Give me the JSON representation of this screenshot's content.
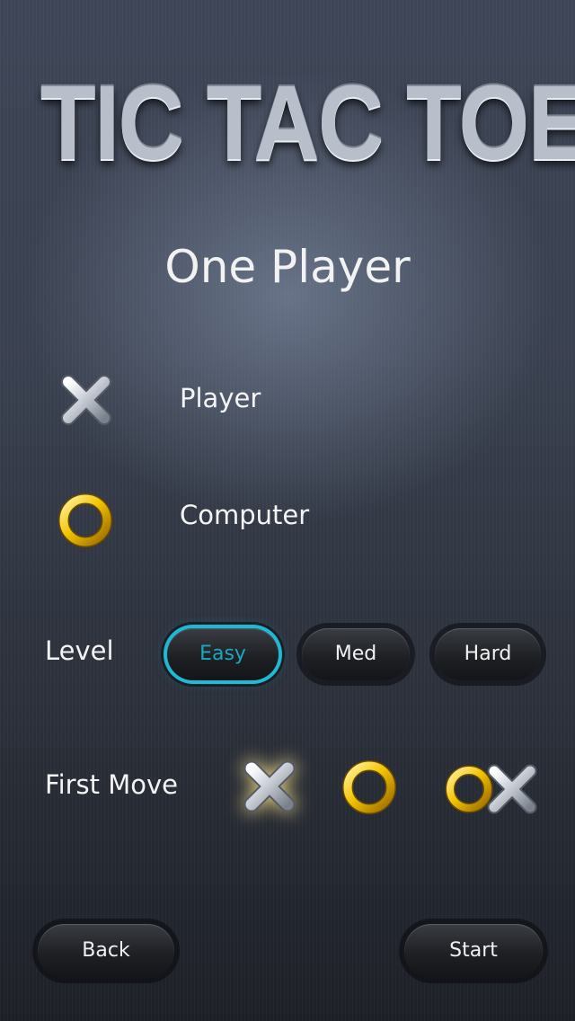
{
  "app": {
    "title": "TIC TAC TOE",
    "mode": "One Player"
  },
  "markers": {
    "player": {
      "icon": "x-mark-icon",
      "label": "Player"
    },
    "computer": {
      "icon": "o-ring-icon",
      "label": "Computer"
    }
  },
  "level": {
    "label": "Level",
    "options": [
      "Easy",
      "Med",
      "Hard"
    ],
    "selected": "Easy"
  },
  "first_move": {
    "label": "First Move",
    "options": [
      "x-mark-icon",
      "o-ring-icon",
      "random-ox-icon"
    ],
    "selected": "x-mark-icon"
  },
  "footer": {
    "back_label": "Back",
    "start_label": "Start"
  },
  "colors": {
    "accent": "#21b8d6",
    "gold": "#e8b400",
    "silver": "#c9ced6"
  }
}
